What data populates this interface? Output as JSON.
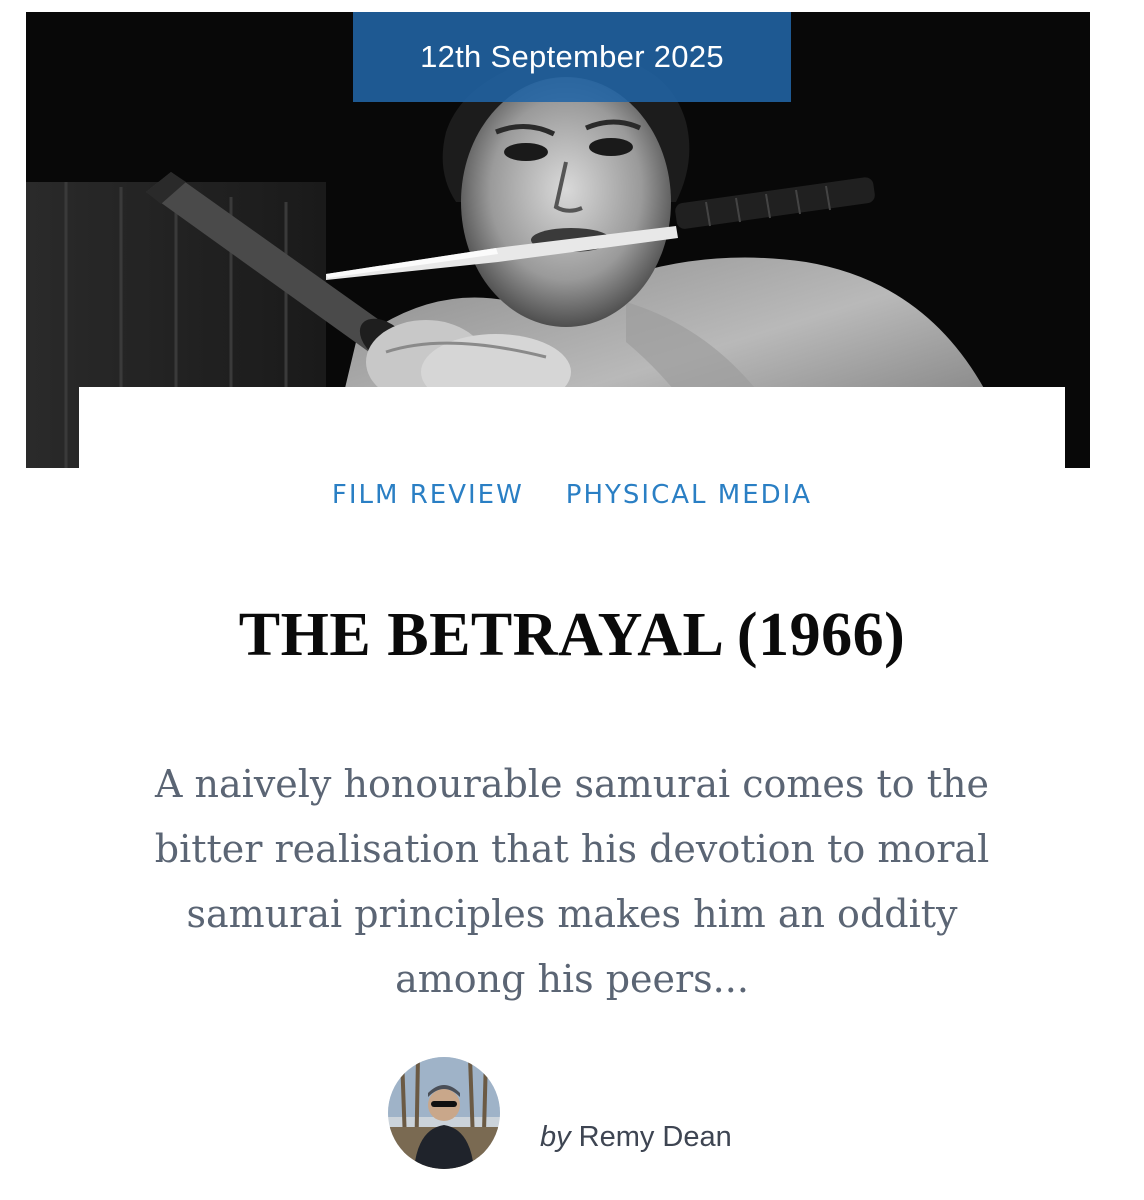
{
  "post": {
    "date": "12th September 2025",
    "categories": [
      "FILM REVIEW",
      "PHYSICAL MEDIA"
    ],
    "title": "THE BETRAYAL (1966)",
    "excerpt": "A naively honourable samurai comes to the bitter realisation that his devotion to moral samurai principles makes him an oddity among his peers...",
    "author": {
      "by": "by",
      "name": "Remy Dean"
    }
  },
  "colors": {
    "accent": "#2a7fc4",
    "date_badge": "#2164a5",
    "title": "#0a0a0a",
    "excerpt": "#5b6574",
    "background": "#ffffff"
  },
  "icons": {
    "hero": "samurai-with-knife-photo",
    "avatar": "author-avatar-photo"
  }
}
